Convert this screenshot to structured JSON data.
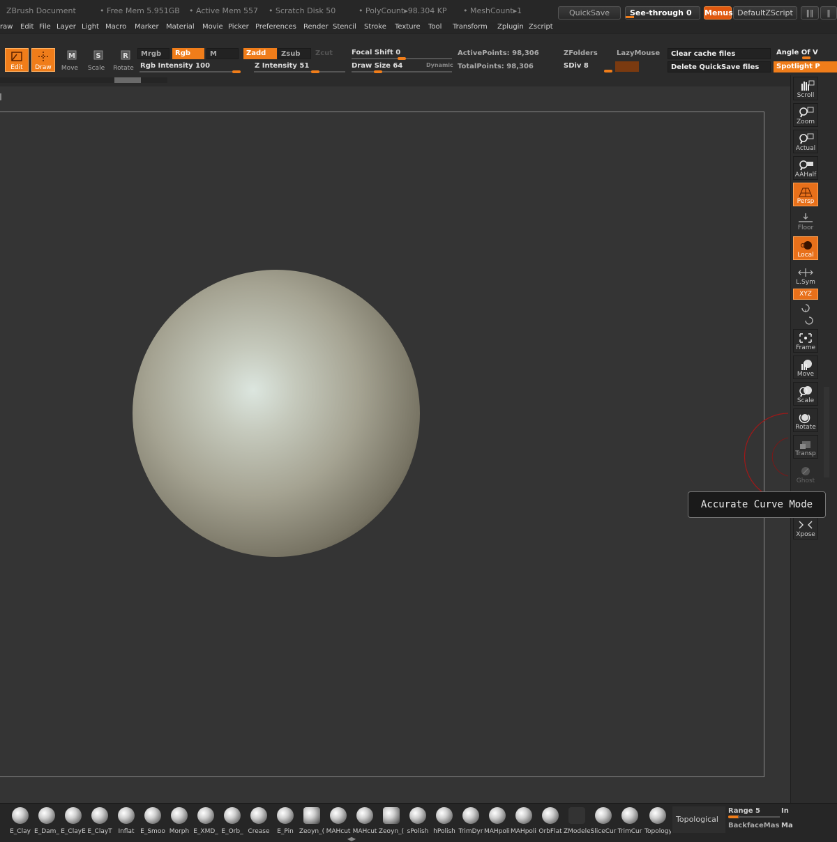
{
  "titlebar": {
    "app": "ZBrush Document",
    "free_mem": "• Free Mem 5.951GB",
    "active_mem": "• Active Mem 557",
    "scratch": "• Scratch Disk 50",
    "polycount": "• PolyCount▸98.304 KP",
    "meshcount": "• MeshCount▸1",
    "quicksave": "QuickSave",
    "see_through": "See-through",
    "see_through_value": "0",
    "menus": "Menus",
    "default_zscript": "DefaultZScript"
  },
  "menubar": [
    "raw",
    "Edit",
    "File",
    "Layer",
    "Light",
    "Macro",
    "Marker",
    "Material",
    "Movie",
    "Picker",
    "Preferences",
    "Render",
    "Stencil",
    "Stroke",
    "Texture",
    "Tool",
    "Transform",
    "Zplugin",
    "Zscript"
  ],
  "toolbar": {
    "edit": "Edit",
    "draw": "Draw",
    "move": "Move",
    "scale": "Scale",
    "rotate": "Rotate",
    "mrgb": "Mrgb",
    "rgb": "Rgb",
    "m": "M",
    "zadd": "Zadd",
    "zsub": "Zsub",
    "zcut": "Zcut",
    "rgb_intensity": "Rgb Intensity 100",
    "z_intensity": "Z Intensity 51",
    "focal_shift": "Focal Shift 0",
    "draw_size": "Draw Size 64",
    "dynamic": "Dynamic",
    "active_points": "ActivePoints: 98,306",
    "total_points": "TotalPoints: 98,306",
    "zfolders": "ZFolders",
    "lazymouse": "LazyMouse",
    "sdiv": "SDiv 8",
    "clear_cache": "Clear cache files",
    "delete_quicksave": "Delete QuickSave files",
    "angle_of": "Angle Of V",
    "spotlight": "Spotlight P"
  },
  "right_shelf": [
    {
      "label": "Scroll",
      "icon": "scroll-hand-icon",
      "state": "normal"
    },
    {
      "label": "Zoom",
      "icon": "zoom-magnifier-icon",
      "state": "normal"
    },
    {
      "label": "Actual",
      "icon": "actual-magnifier-icon",
      "state": "normal"
    },
    {
      "label": "AAHalf",
      "icon": "aahalf-magnifier-icon",
      "state": "normal"
    },
    {
      "label": "Persp",
      "icon": "perspective-grid-icon",
      "state": "on"
    },
    {
      "label": "Floor",
      "icon": "floor-icon",
      "state": "normal"
    },
    {
      "label": "Local",
      "icon": "local-icon",
      "state": "on"
    },
    {
      "label": "L.Sym",
      "icon": "lsym-icon",
      "state": "normal"
    },
    {
      "label": "XYZ",
      "icon": "xyz-icon",
      "state": "on"
    },
    {
      "label": "Frame",
      "icon": "frame-icon",
      "state": "normal"
    },
    {
      "label": "Move",
      "icon": "move-hand-icon",
      "state": "normal"
    },
    {
      "label": "Scale",
      "icon": "scale-magnifier-icon",
      "state": "normal"
    },
    {
      "label": "Rotate",
      "icon": "rotate-icon",
      "state": "normal"
    },
    {
      "label": "Transp",
      "icon": "transparency-icon",
      "state": "dim"
    },
    {
      "label": "Ghost",
      "icon": "ghost-icon",
      "state": "dim"
    },
    {
      "label": "Xpose",
      "icon": "xpose-icon",
      "state": "normal"
    }
  ],
  "tooltip": "Accurate Curve Mode",
  "brushes": [
    "E_Clay",
    "E_Dam_",
    "E_ClayE",
    "E_ClayT",
    "Inflat",
    "E_Smoo",
    "Morph",
    "E_XMD_",
    "E_Orb_",
    "Crease",
    "E_Pin",
    "Zeoyn_(",
    "MAHcut",
    "MAHcut",
    "Zeoyn_(",
    "sPolish",
    "hPolish",
    "TrimDyr",
    "MAHpoli:",
    "MAHpoli:",
    "OrbFlat",
    "ZModele",
    "SliceCur",
    "TrimCur",
    "Topology"
  ],
  "bottom": {
    "topological": "Topological",
    "range": "Range 5",
    "backface": "BackfaceMas",
    "in": "In",
    "ma": "Ma"
  }
}
